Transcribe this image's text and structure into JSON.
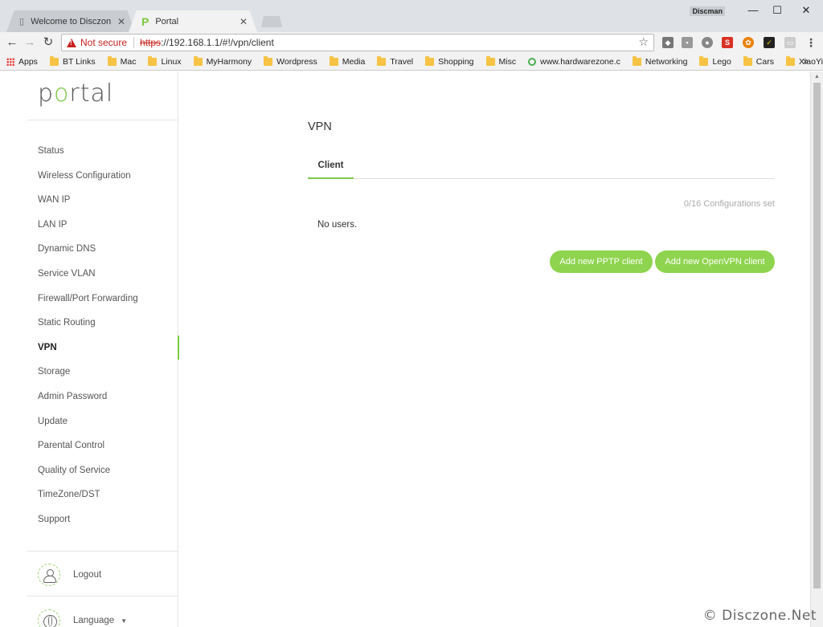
{
  "browser": {
    "tabs": [
      {
        "title": "Welcome to Disczone! -",
        "close": "✕"
      },
      {
        "title": "Portal",
        "close": "✕"
      }
    ],
    "profile": "Discman",
    "window_controls": {
      "minimize": "—",
      "maximize": "☐",
      "close": "✕"
    },
    "security_label": "Not secure",
    "url_scheme": "https",
    "url_rest": "://192.168.1.1/#!/vpn/client",
    "bookmarks": [
      {
        "label": "Apps",
        "icon": "apps-icon"
      },
      {
        "label": "BT Links",
        "icon": "folder-icon"
      },
      {
        "label": "Mac",
        "icon": "folder-icon"
      },
      {
        "label": "Linux",
        "icon": "folder-icon"
      },
      {
        "label": "MyHarmony",
        "icon": "folder-icon"
      },
      {
        "label": "Wordpress",
        "icon": "folder-icon"
      },
      {
        "label": "Media",
        "icon": "folder-icon"
      },
      {
        "label": "Travel",
        "icon": "folder-icon"
      },
      {
        "label": "Shopping",
        "icon": "folder-icon"
      },
      {
        "label": "Misc",
        "icon": "folder-icon"
      },
      {
        "label": "www.hardwarezone.c",
        "icon": "site-icon"
      },
      {
        "label": "Networking",
        "icon": "folder-icon"
      },
      {
        "label": "Lego",
        "icon": "folder-icon"
      },
      {
        "label": "Cars",
        "icon": "folder-icon"
      },
      {
        "label": "XiaoYi",
        "icon": "folder-icon"
      }
    ],
    "bookmarks_more": "»"
  },
  "sidebar": {
    "logo": {
      "p": "p",
      "o": "o",
      "rest": "rtal"
    },
    "items": [
      {
        "label": "Status",
        "active": false
      },
      {
        "label": "Wireless Configuration",
        "active": false
      },
      {
        "label": "WAN IP",
        "active": false
      },
      {
        "label": "LAN IP",
        "active": false
      },
      {
        "label": "Dynamic DNS",
        "active": false
      },
      {
        "label": "Service VLAN",
        "active": false
      },
      {
        "label": "Firewall/Port Forwarding",
        "active": false
      },
      {
        "label": "Static Routing",
        "active": false
      },
      {
        "label": "VPN",
        "active": true
      },
      {
        "label": "Storage",
        "active": false
      },
      {
        "label": "Admin Password",
        "active": false
      },
      {
        "label": "Update",
        "active": false
      },
      {
        "label": "Parental Control",
        "active": false
      },
      {
        "label": "Quality of Service",
        "active": false
      },
      {
        "label": "TimeZone/DST",
        "active": false
      },
      {
        "label": "Support",
        "active": false
      }
    ],
    "logout": "Logout",
    "language": "Language"
  },
  "main": {
    "title": "VPN",
    "tabs": [
      {
        "label": "Client",
        "active": true
      }
    ],
    "config_count": "0/16 Configurations set",
    "empty_message": "No users.",
    "buttons": {
      "add_pptp": "Add new PPTP client",
      "add_openvpn": "Add new OpenVPN client"
    }
  },
  "watermark": "© Disczone.Net",
  "colors": {
    "accent": "#8fd44f",
    "warning": "#c5221f"
  }
}
